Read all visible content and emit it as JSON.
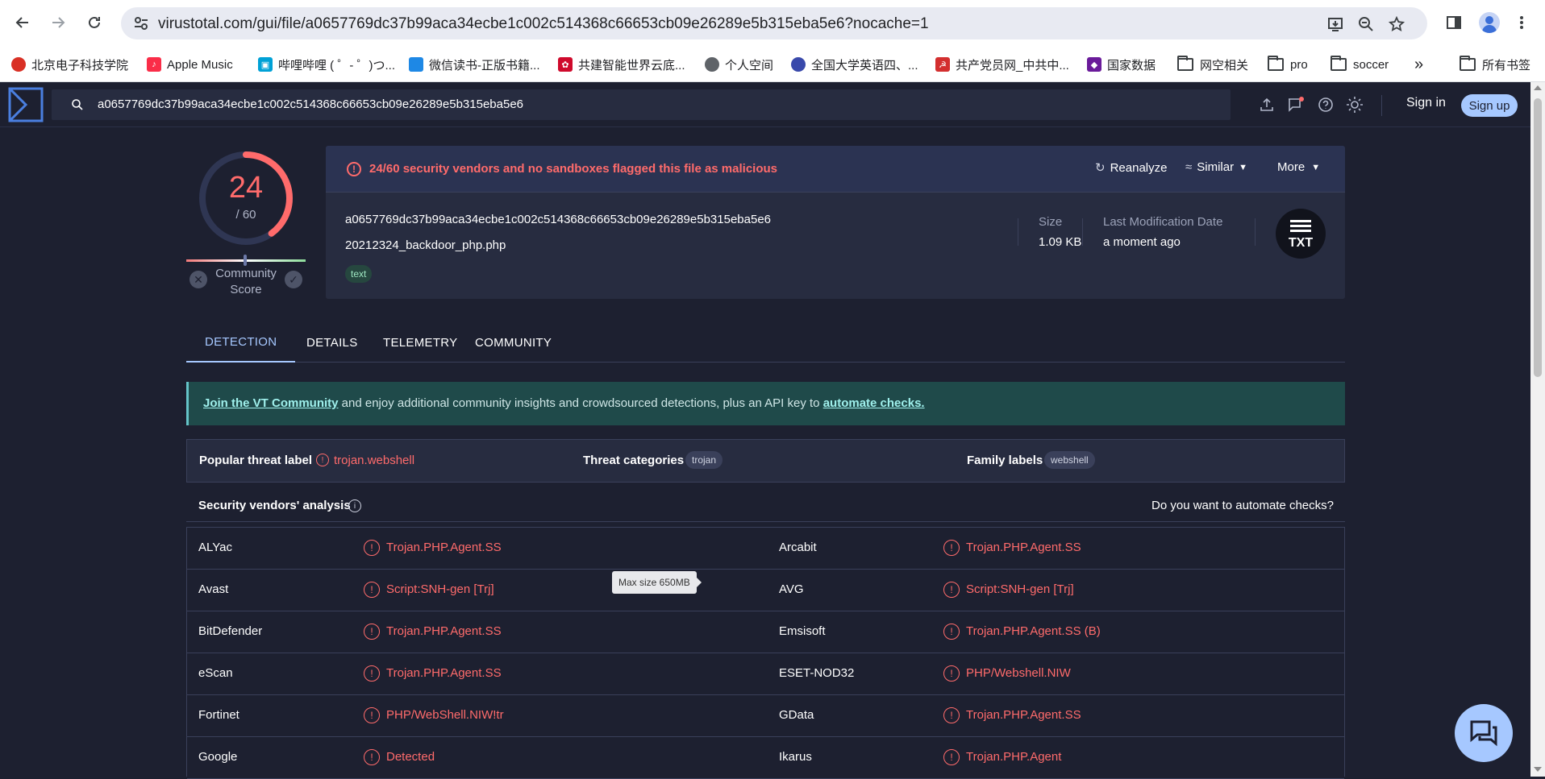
{
  "browser": {
    "url": "virustotal.com/gui/file/a0657769dc37b99aca34ecbe1c002c514368c66653cb09e26289e5b315eba5e6?nocache=1",
    "bookmarks": [
      {
        "label": "北京电子科技学院",
        "icon": "globe-red",
        "color": "#d93025"
      },
      {
        "label": "Apple Music",
        "icon": "music-icon",
        "color": "#fa2d48"
      },
      {
        "label": "哔哩哔哩 ( ゜- ゜)つ...",
        "icon": "bilibili-icon",
        "color": "#00a1d6"
      },
      {
        "label": "微信读书-正版书籍...",
        "icon": "wechat-read-icon",
        "color": "#1e88e5"
      },
      {
        "label": "共建智能世界云底...",
        "icon": "huawei-icon",
        "color": "#cf0a2c"
      },
      {
        "label": "个人空间",
        "icon": "globe-icon",
        "color": "#5f6368"
      },
      {
        "label": "全国大学英语四、...",
        "icon": "cet-icon",
        "color": "#3949ab"
      },
      {
        "label": "共产党员网_中共中...",
        "icon": "party-icon",
        "color": "#d32f2f"
      },
      {
        "label": "国家数据",
        "icon": "data-icon",
        "color": "#6a1b9a"
      }
    ],
    "folders": [
      "网空相关",
      "pro",
      "soccer"
    ],
    "more_label": "»",
    "all_bookmarks": "所有书签"
  },
  "vt": {
    "search_value": "a0657769dc37b99aca34ecbe1c002c514368c66653cb09e26289e5b315eba5e6",
    "sign_in": "Sign in",
    "sign_up": "Sign up",
    "score": {
      "detected": "24",
      "total": "/ 60",
      "fraction": 0.4,
      "community_label": "Community Score"
    },
    "alert": "24/60 security vendors and no sandboxes flagged this file as malicious",
    "actions": {
      "reanalyze": "Reanalyze",
      "similar": "Similar",
      "more": "More"
    },
    "file": {
      "hash": "a0657769dc37b99aca34ecbe1c002c514368c66653cb09e26289e5b315eba5e6",
      "name": "20212324_backdoor_php.php",
      "tag": "text",
      "size_label": "Size",
      "size_value": "1.09 KB",
      "mod_label": "Last Modification Date",
      "mod_value": "a moment ago",
      "type_icon": "TXT"
    },
    "tabs": [
      "DETECTION",
      "DETAILS",
      "TELEMETRY",
      "COMMUNITY"
    ],
    "join": {
      "link1": "Join the VT Community",
      "middle": " and enjoy additional community insights and crowdsourced detections, plus an API key to ",
      "link2": "automate checks."
    },
    "threat": {
      "popular_label": "Popular threat label",
      "popular_value": "trojan.webshell",
      "categories_label": "Threat categories",
      "category_chip": "trojan",
      "family_label": "Family labels",
      "family_chip": "webshell"
    },
    "analysis": {
      "title": "Security vendors' analysis",
      "automate": "Do you want to automate checks?",
      "rows": [
        {
          "v1": "ALYac",
          "r1": "Trojan.PHP.Agent.SS",
          "v2": "Arcabit",
          "r2": "Trojan.PHP.Agent.SS"
        },
        {
          "v1": "Avast",
          "r1": "Script:SNH-gen [Trj]",
          "v2": "AVG",
          "r2": "Script:SNH-gen [Trj]"
        },
        {
          "v1": "BitDefender",
          "r1": "Trojan.PHP.Agent.SS",
          "v2": "Emsisoft",
          "r2": "Trojan.PHP.Agent.SS (B)"
        },
        {
          "v1": "eScan",
          "r1": "Trojan.PHP.Agent.SS",
          "v2": "ESET-NOD32",
          "r2": "PHP/Webshell.NIW"
        },
        {
          "v1": "Fortinet",
          "r1": "PHP/WebShell.NIW!tr",
          "v2": "GData",
          "r2": "Trojan.PHP.Agent.SS"
        },
        {
          "v1": "Google",
          "r1": "Detected",
          "v2": "Ikarus",
          "r2": "Trojan.PHP.Agent"
        }
      ]
    },
    "tooltip": "Max size 650MB"
  }
}
